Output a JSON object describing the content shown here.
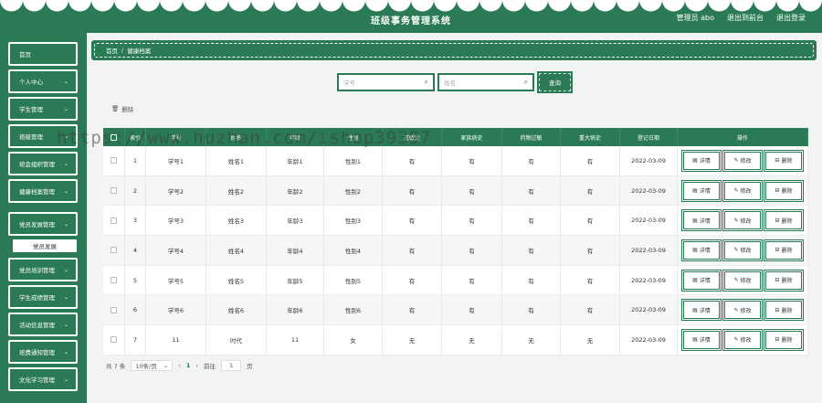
{
  "header": {
    "title": "班级事务管理系统",
    "links": [
      "管理员 abo",
      "退出到前台",
      "退出登录"
    ]
  },
  "sidebar": {
    "items": [
      {
        "label": "首页",
        "chevron": false
      },
      {
        "label": "个人中心",
        "chevron": true
      },
      {
        "label": "学生管理",
        "chevron": true
      },
      {
        "label": "班级管理",
        "chevron": true
      },
      {
        "label": "班会组织管理",
        "chevron": true
      },
      {
        "label": "健康档案管理",
        "chevron": true
      },
      {
        "label": "党员发展管理",
        "chevron": true
      },
      {
        "label": "党员培训管理",
        "chevron": true
      },
      {
        "label": "学生成绩管理",
        "chevron": true
      },
      {
        "label": "活动信息管理",
        "chevron": true
      },
      {
        "label": "班费通知管理",
        "chevron": true
      },
      {
        "label": "文化学习管理",
        "chevron": true
      }
    ],
    "sub_item": "党员发展"
  },
  "breadcrumb": {
    "home": "首页",
    "sep": "/",
    "current": "健康档案"
  },
  "search": {
    "field1_placeholder": "学号",
    "field2_placeholder": "姓名",
    "query_label": "查询"
  },
  "delete_label": "删除",
  "table": {
    "columns": [
      "",
      "索引",
      "学号",
      "姓名",
      "年龄",
      "性别",
      "过敏史",
      "家族病史",
      "药物过敏",
      "重大病史",
      "登记日期",
      "操作"
    ],
    "rows": [
      [
        "1",
        "学号1",
        "姓名1",
        "年龄1",
        "性别1",
        "有",
        "有",
        "有",
        "有",
        "2022-03-09"
      ],
      [
        "2",
        "学号2",
        "姓名2",
        "年龄2",
        "性别2",
        "有",
        "有",
        "有",
        "有",
        "2022-03-09"
      ],
      [
        "3",
        "学号3",
        "姓名3",
        "年龄3",
        "性别3",
        "有",
        "有",
        "有",
        "有",
        "2022-03-09"
      ],
      [
        "4",
        "学号4",
        "姓名4",
        "年龄4",
        "性别4",
        "有",
        "有",
        "有",
        "有",
        "2022-03-09"
      ],
      [
        "5",
        "学号5",
        "姓名5",
        "年龄5",
        "性别5",
        "有",
        "有",
        "有",
        "有",
        "2022-03-09"
      ],
      [
        "6",
        "学号6",
        "姓名6",
        "年龄6",
        "性别6",
        "有",
        "有",
        "有",
        "有",
        "2022-03-09"
      ],
      [
        "7",
        "11",
        "时代",
        "11",
        "女",
        "无",
        "无",
        "无",
        "无",
        "2022-03-09"
      ]
    ],
    "op_labels": [
      "详情",
      "修改",
      "删除"
    ]
  },
  "pager": {
    "total": "共 7 条",
    "page_size": "10条/页",
    "prev": "‹",
    "page": "1",
    "next": "›",
    "goto_label": "前往",
    "goto_value": "1",
    "page_suffix": "页"
  },
  "watermark": "https://www.huzhan.com/ishop39397",
  "colors": {
    "primary": "#2a7a55",
    "background": "#f2f4f3"
  }
}
